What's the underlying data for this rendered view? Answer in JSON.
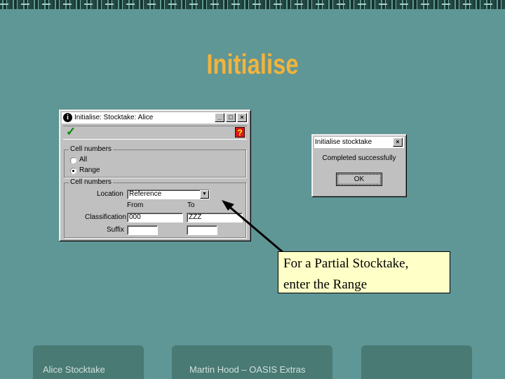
{
  "slide": {
    "title": "Initialise",
    "callout_line1": "For a Partial Stocktake,",
    "callout_line2": "enter the Range"
  },
  "main_window": {
    "title": "Initialise: Stocktake: Alice",
    "minimize_glyph": "_",
    "maximize_glyph": "□",
    "close_glyph": "×",
    "check_glyph": "✓",
    "help_glyph": "?",
    "group1_label": "Cell numbers",
    "radio_all": "All",
    "radio_range": "Range",
    "selected_radio": "Range",
    "group2_label": "Cell numbers",
    "location_label": "Location",
    "location_value": "Reference",
    "from_label": "From",
    "to_label": "To",
    "classification_label": "Classification",
    "classification_from": "000",
    "classification_to": "ZZZ",
    "suffix_label": "Suffix",
    "suffix_from": "",
    "suffix_to": ""
  },
  "msg_window": {
    "title": "Initialise stocktake",
    "close_glyph": "×",
    "message": "Completed successfully",
    "ok_label": "OK"
  },
  "footer": {
    "left": "Alice Stocktake",
    "center": "Martin Hood – OASIS Extras",
    "right": ""
  },
  "colors": {
    "background": "#5f9696",
    "title": "#f2b33c",
    "callout_bg": "#ffffc8",
    "footer_box": "#497a74"
  }
}
